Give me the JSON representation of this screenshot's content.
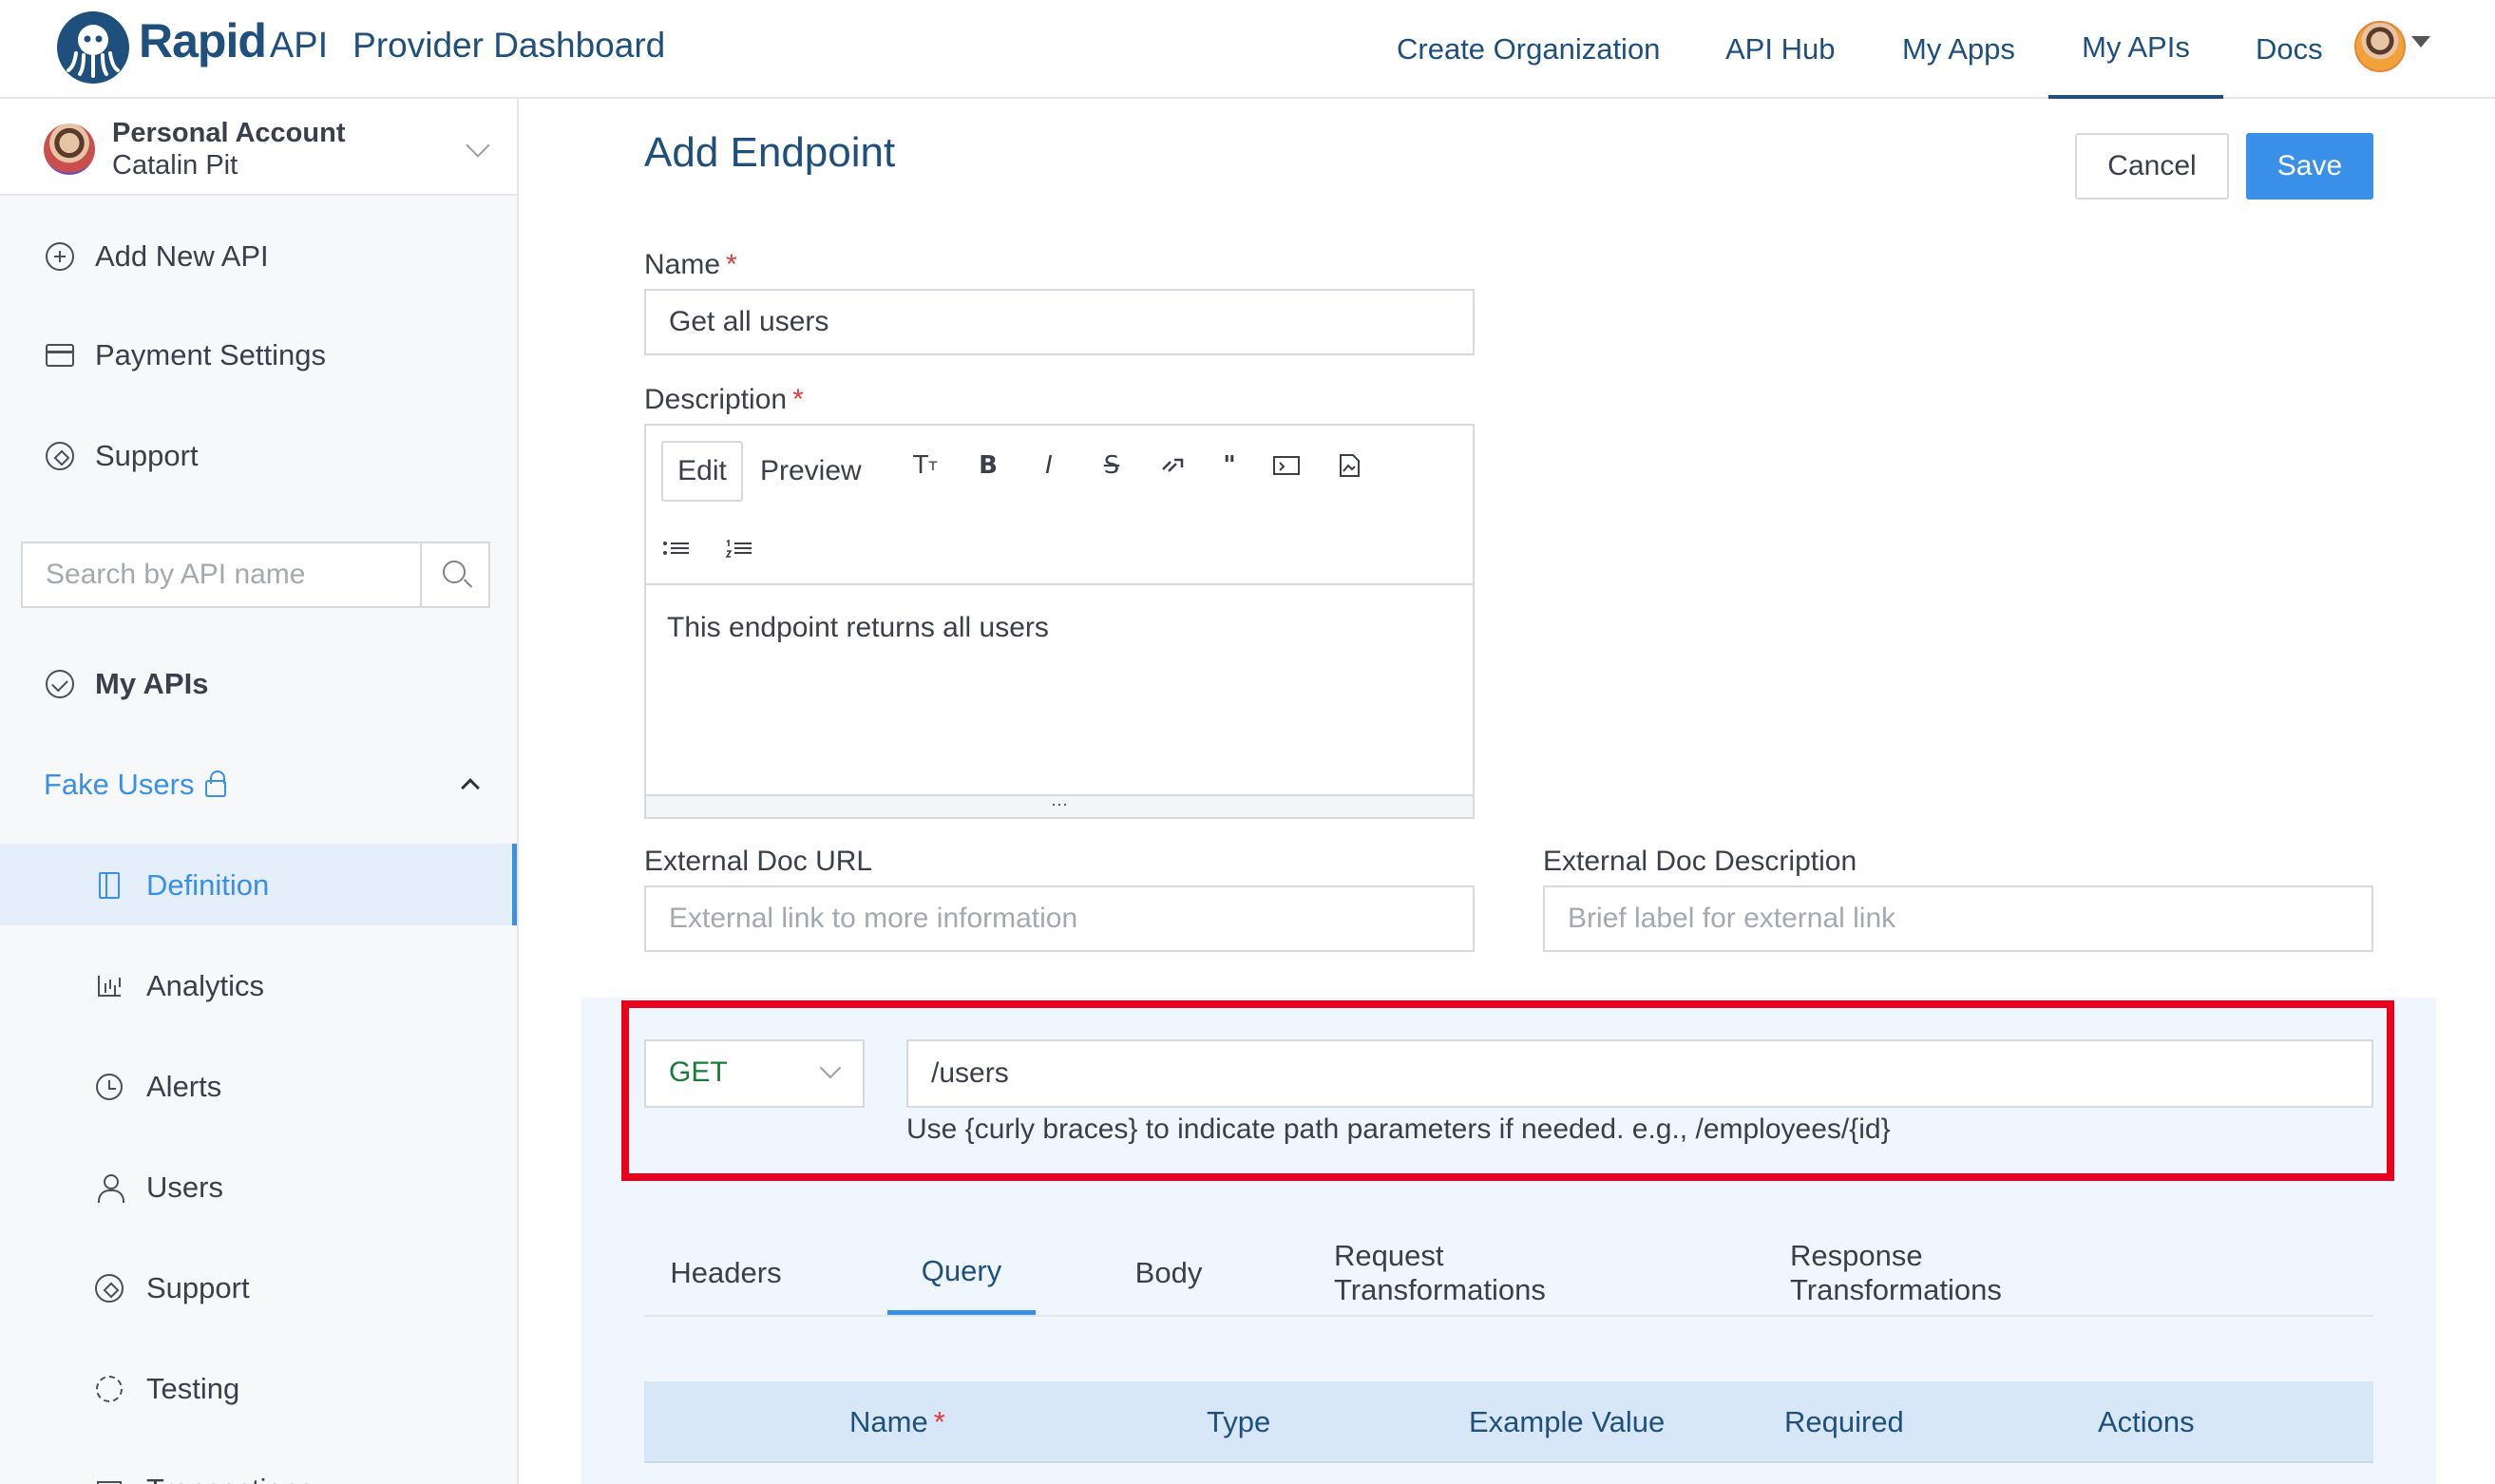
{
  "header": {
    "brand_rapid": "Rapid",
    "brand_api": "API",
    "brand_title": "Provider Dashboard",
    "nav": [
      "Create Organization",
      "API Hub",
      "My Apps",
      "My APIs",
      "Docs"
    ],
    "active_nav": "My APIs"
  },
  "sidebar": {
    "account_title": "Personal Account",
    "account_user": "Catalin Pit",
    "items": [
      "Add New API",
      "Payment Settings",
      "Support"
    ],
    "search_placeholder": "Search by API name",
    "my_apis": "My APIs",
    "api_name": "Fake Users",
    "sub_items": [
      "Definition",
      "Analytics",
      "Alerts",
      "Users",
      "Support",
      "Testing",
      "Transactions"
    ],
    "active_sub_item": "Definition"
  },
  "main": {
    "title": "Add Endpoint",
    "cancel": "Cancel",
    "save": "Save",
    "name_label": "Name",
    "name_value": "Get all users",
    "description_label": "Description",
    "editor_tabs": [
      "Edit",
      "Preview"
    ],
    "editor_tools": [
      "Tт",
      "B",
      "I",
      "S",
      "link",
      "quote",
      "code",
      "image",
      "bulleted-list",
      "numbered-list"
    ],
    "description_value": "This endpoint returns all users",
    "ext_url_label": "External Doc URL",
    "ext_url_placeholder": "External link to more information",
    "ext_desc_label": "External Doc Description",
    "ext_desc_placeholder": "Brief label for external link",
    "method": "GET",
    "path_value": "/users",
    "path_hint": "Use {curly braces} to indicate path parameters if needed. e.g., /employees/{id}",
    "param_tabs": [
      "Headers",
      "Query",
      "Body",
      "Request Transformations",
      "Response Transformations"
    ],
    "active_param_tab": "Query",
    "table_headers": [
      "Name",
      "Type",
      "Example Value",
      "Required",
      "Actions"
    ]
  },
  "colors": {
    "brand": "#1f4f7d",
    "accent": "#3a8fe8",
    "highlight": "#e8001c",
    "method_get": "#1a7a3a"
  }
}
